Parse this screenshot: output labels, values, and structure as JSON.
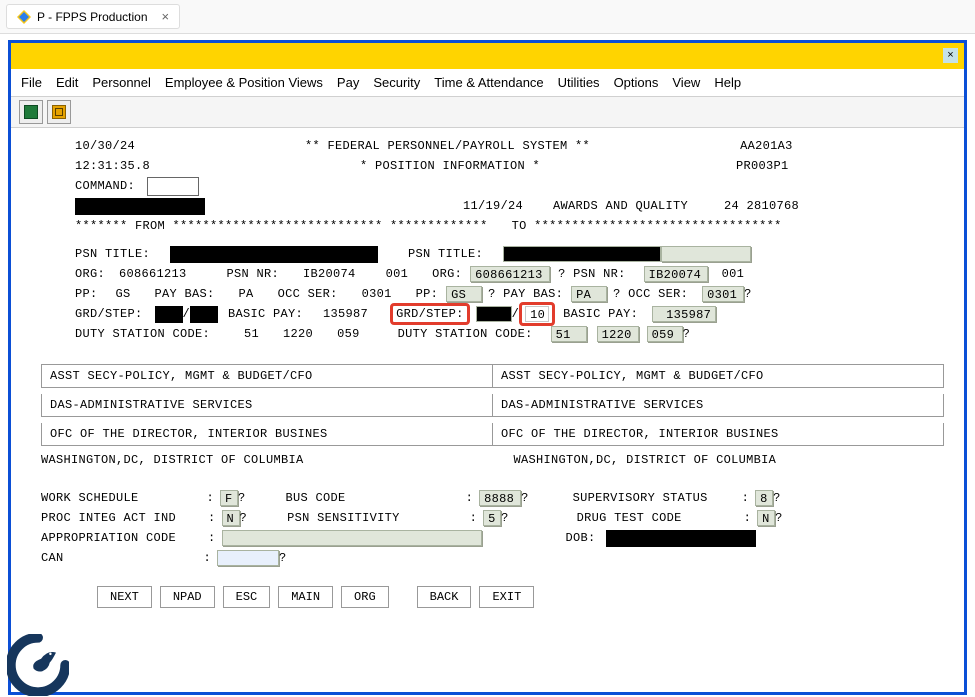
{
  "tab": {
    "title": "P - FPPS Production"
  },
  "menu": [
    "File",
    "Edit",
    "Personnel",
    "Employee & Position Views",
    "Pay",
    "Security",
    "Time & Attendance",
    "Utilities",
    "Options",
    "View",
    "Help"
  ],
  "header": {
    "date": "10/30/24",
    "time": "12:31:35.8",
    "system_banner": "** FEDERAL PERSONNEL/PAYROLL SYSTEM **",
    "screen_title": "* POSITION INFORMATION *",
    "code1": "AA201A3",
    "code2": "PR003P1",
    "command_label": "COMMAND:"
  },
  "action_line": {
    "eff_date": "11/19/24",
    "action_text": "AWARDS AND QUALITY",
    "seq": "24 2810768"
  },
  "from_to": {
    "from_label": "******* FROM  ****************************  *************",
    "to_label": "TO   *********************************"
  },
  "left": {
    "psn_title_label": "PSN TITLE:",
    "org_label": "ORG:",
    "org": "608661213",
    "psn_nr_label": "PSN NR:",
    "psn_nr": "IB20074",
    "psn_nr_seq": "001",
    "pp_label": "PP:",
    "pp": "GS",
    "paybas_label": "PAY BAS:",
    "paybas": "PA",
    "occser_label": "OCC SER:",
    "occser": "0301",
    "grdstep_label": "GRD/STEP:",
    "basicpay_label": "BASIC PAY:",
    "basicpay": "135987",
    "duty_label": "DUTY STATION CODE:",
    "duty1": "51",
    "duty2": "1220",
    "duty3": "059"
  },
  "right": {
    "psn_title_label": "PSN TITLE:",
    "org_label": "ORG:",
    "org": "608661213",
    "psn_nr_label": "? PSN NR:",
    "psn_nr": "IB20074",
    "psn_nr_seq": "001",
    "pp_label": "PP:",
    "pp": "GS",
    "paybas_label": "? PAY BAS:",
    "paybas": "PA",
    "occser_label": "? OCC SER:",
    "occser": "0301",
    "grdstep_label": "GRD/STEP:",
    "step": "10",
    "basicpay_label": "BASIC PAY:",
    "basicpay": "135987",
    "duty_label": "DUTY STATION CODE:",
    "duty1": "51",
    "duty2": "1220",
    "duty3": "059"
  },
  "org_boxes": {
    "l1": "ASST SECY-POLICY, MGMT & BUDGET/CFO",
    "l2": "DAS-ADMINISTRATIVE SERVICES",
    "l3": "OFC OF THE DIRECTOR, INTERIOR BUSINES",
    "loc": "WASHINGTON,DC, DISTRICT OF COLUMBIA"
  },
  "bottom": {
    "work_schedule_label": "WORK SCHEDULE",
    "work_schedule": "F",
    "bus_code_label": "BUS CODE",
    "bus_code": "8888",
    "sup_status_label": "SUPERVISORY STATUS",
    "sup_status": "8",
    "proc_label": "PROC INTEG ACT IND",
    "proc": "N",
    "psn_sens_label": "PSN SENSITIVITY",
    "psn_sens": "5",
    "drug_label": "DRUG TEST CODE",
    "drug": "N",
    "approp_label": "APPROPRIATION CODE",
    "dob_label": "DOB:",
    "can_label": "CAN"
  },
  "buttons": [
    "NEXT",
    "NPAD",
    "ESC",
    "MAIN",
    "ORG",
    "BACK",
    "EXIT"
  ]
}
